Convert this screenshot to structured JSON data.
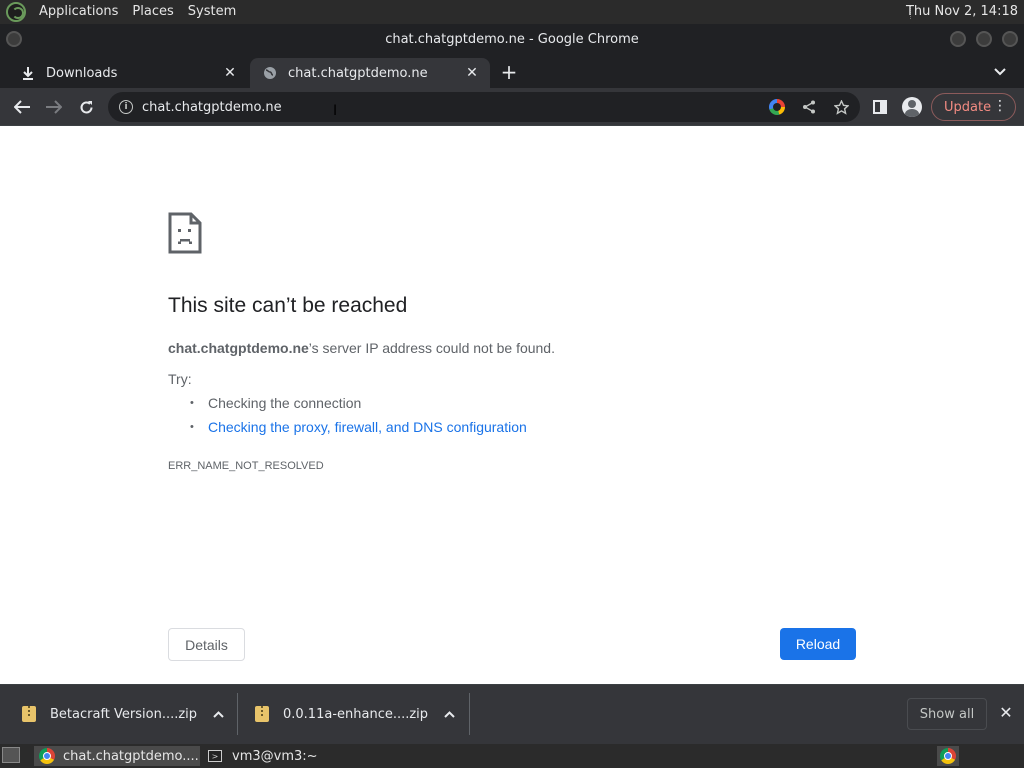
{
  "top_panel": {
    "menus": [
      "Applications",
      "Places",
      "System"
    ],
    "clock": "Thu Nov  2, 14:18"
  },
  "window": {
    "title": "chat.chatgptdemo.ne - Google Chrome"
  },
  "tabs": [
    {
      "label": "Downloads",
      "icon": "download-icon",
      "active": false
    },
    {
      "label": "chat.chatgptdemo.ne",
      "icon": "globe-icon",
      "active": true
    }
  ],
  "toolbar": {
    "url": "chat.chatgptdemo.ne",
    "update_label": "Update"
  },
  "error_page": {
    "title": "This site can’t be reached",
    "host": "chat.chatgptdemo.ne",
    "desc_suffix": "’s server IP address could not be found.",
    "try_label": "Try:",
    "suggestions": [
      {
        "text": "Checking the connection",
        "link": false
      },
      {
        "text": "Checking the proxy, firewall, and DNS configuration",
        "link": true
      }
    ],
    "error_code": "ERR_NAME_NOT_RESOLVED",
    "details_label": "Details",
    "reload_label": "Reload"
  },
  "downloads": {
    "items": [
      {
        "name": "Betacraft Version....zip"
      },
      {
        "name": "0.0.11a-enhance....zip"
      }
    ],
    "show_all_label": "Show all"
  },
  "taskbar": {
    "tasks": [
      {
        "label": "chat.chatgptdemo....",
        "icon": "chrome-icon",
        "active": true
      },
      {
        "label": "vm3@vm3:~",
        "icon": "terminal-icon",
        "active": false
      }
    ]
  },
  "colors": {
    "accent": "#1a73e8",
    "chrome_dark": "#35363a",
    "update_text": "#f28b82"
  }
}
